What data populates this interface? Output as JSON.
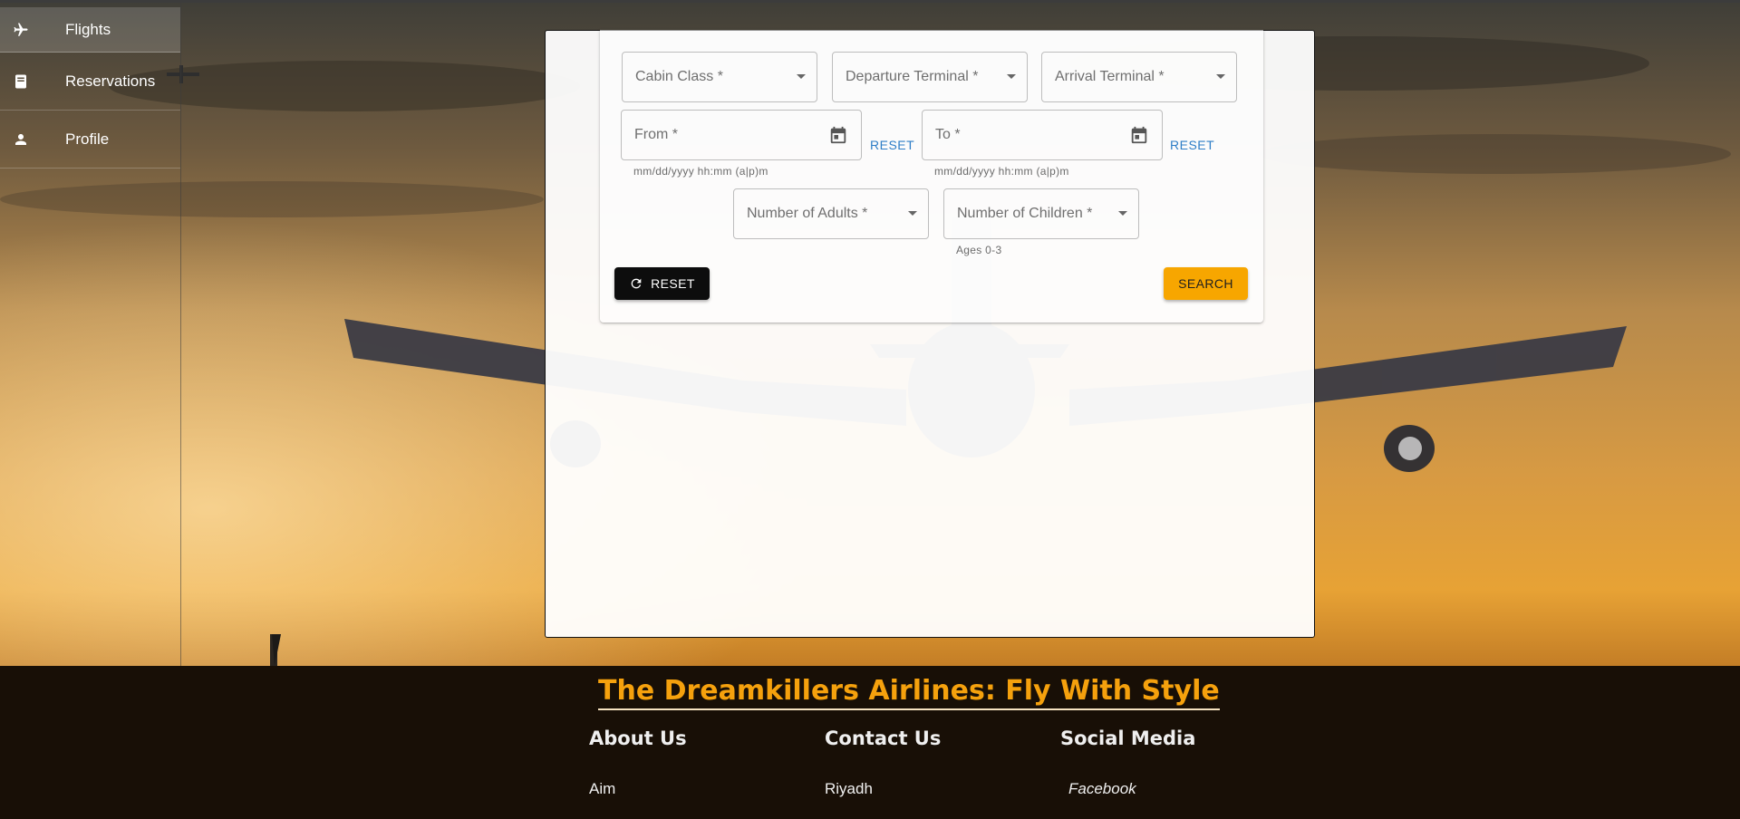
{
  "sidebar": {
    "items": [
      {
        "label": "Flights",
        "icon": "airplane-icon",
        "active": true
      },
      {
        "label": "Reservations",
        "icon": "book-icon",
        "active": false
      },
      {
        "label": "Profile",
        "icon": "person-icon",
        "active": false
      }
    ]
  },
  "search_form": {
    "cabin_class_label": "Cabin Class *",
    "departure_terminal_label": "Departure Terminal *",
    "arrival_terminal_label": "Arrival Terminal *",
    "from_label": "From *",
    "to_label": "To *",
    "date_format_hint": "mm/dd/yyyy hh:mm (a|p)m",
    "field_reset_label": "RESET",
    "adults_label": "Number of Adults *",
    "children_label": "Number of Children *",
    "children_hint": "Ages 0-3",
    "reset_button_label": "RESET",
    "search_button_label": "SEARCH"
  },
  "footer": {
    "title": "The Dreamkillers Airlines: Fly With Style",
    "about": {
      "heading": "About Us",
      "link": "Aim"
    },
    "contact": {
      "heading": "Contact Us",
      "link": "Riyadh"
    },
    "social": {
      "heading": "Social Media",
      "link": "Facebook"
    }
  },
  "colors": {
    "accent": "#f7a600",
    "link": "#2f7ec7",
    "footer_title": "#f5a10d"
  }
}
